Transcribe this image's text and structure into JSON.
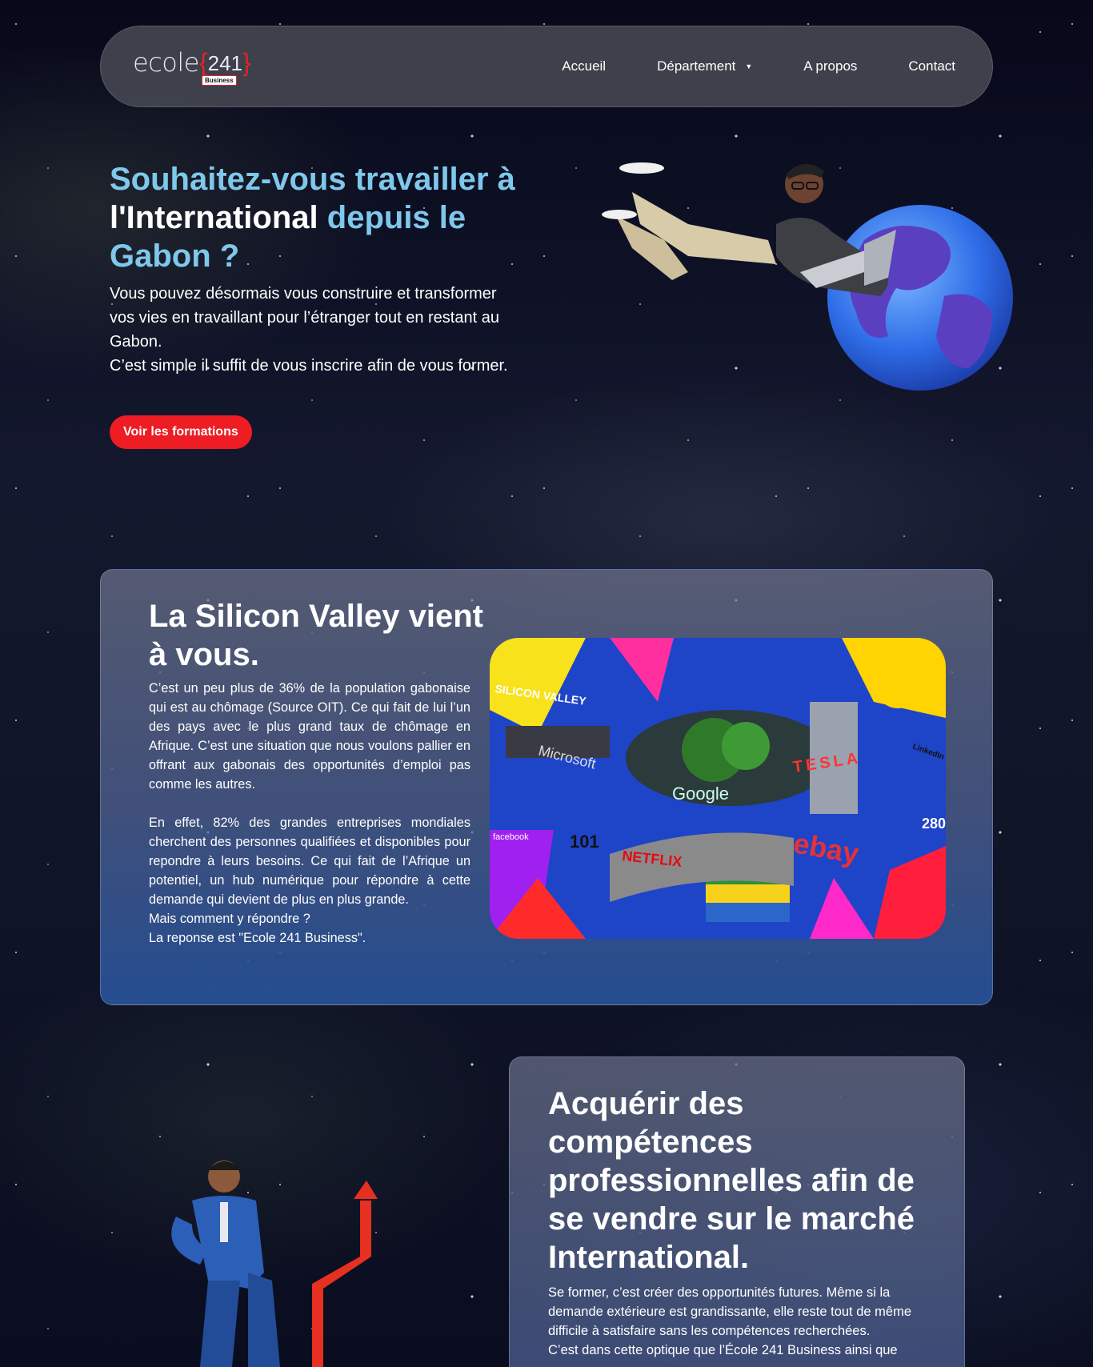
{
  "nav": {
    "logo": {
      "word": "ecole",
      "open": "{",
      "num": "241",
      "close": "}",
      "sub": "Business"
    },
    "items": [
      {
        "label": "Accueil"
      },
      {
        "label": "Département",
        "caret": "▼"
      },
      {
        "label": "A propos"
      },
      {
        "label": "Contact"
      }
    ]
  },
  "hero": {
    "title_part1": "Souhaitez-vous travailler à ",
    "title_part2": "l'International",
    "title_part3": " depuis le Gabon ?",
    "paragraph1": "Vous pouvez désormais vous construire et transformer vos vies en travaillant pour l’étranger tout en restant au Gabon.",
    "paragraph2": "C’est simple il suffit de vous inscrire afin de vous former.",
    "cta": "Voir les formations"
  },
  "silicon": {
    "title": "La Silicon Valley vient à vous.",
    "p1": "C’est un peu plus de 36% de la population gabonaise qui est au chômage (Source OIT). Ce qui fait de lui l’un des pays avec le plus grand taux de chômage en Afrique. C’est une situation que nous voulons pallier en offrant aux gabonais des opportunités d’emploi pas comme les autres.",
    "p2": "En effet, 82% des grandes entreprises mondiales cherchent des personnes qualifiées et disponibles pour repondre à leurs besoins. Ce qui fait de l’Afrique un potentiel, un hub numérique pour répondre à cette demande qui devient de plus en plus grande.",
    "p3": "Mais comment y répondre ?",
    "p4": "La reponse est \"Ecole 241 Business\".",
    "collage_labels": [
      "SILICON VALLEY",
      "Microsoft",
      "Google",
      "TESLA",
      "ebay",
      "NETFLIX",
      "facebook",
      "101",
      "280",
      "LinkedIn"
    ]
  },
  "skills": {
    "title": "Acquérir des compétences professionnelles afin de se vendre sur le marché International.",
    "p1": "Se former, c’est créer des opportunités futures. Même si la demande extérieure est grandissante, elle reste tout de même difficile à satisfaire sans les compétences recherchées.",
    "p2": "C’est dans cette optique que l’École 241 Business ainsi que"
  },
  "colors": {
    "accent_blue": "#7fc8ec",
    "cta_red": "#ee1d23",
    "logo_red": "#e0242c"
  }
}
